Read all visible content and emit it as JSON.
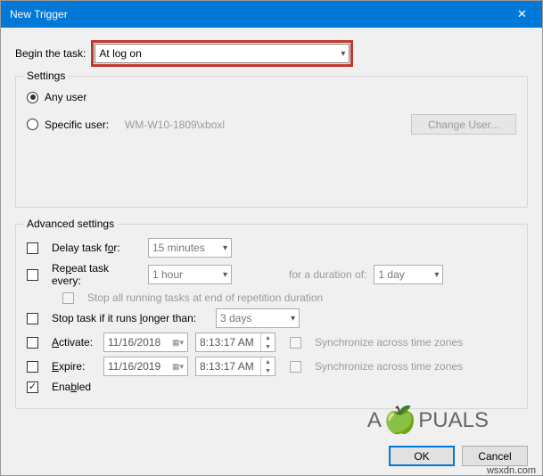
{
  "window": {
    "title": "New Trigger",
    "close_glyph": "✕"
  },
  "begin": {
    "label": "Begin the task:",
    "value": "At log on"
  },
  "settings": {
    "title": "Settings",
    "any_user": "Any user",
    "specific_user": "Specific user:",
    "user_value": "WM-W10-1809\\xboxl",
    "change_user": "Change User..."
  },
  "advanced": {
    "title": "Advanced settings",
    "delay_label": "Delay task for:",
    "delay_value": "15 minutes",
    "repeat_label": "Repeat task every:",
    "repeat_value": "1 hour",
    "duration_label": "for a duration of:",
    "duration_value": "1 day",
    "stop_repetition": "Stop all running tasks at end of repetition duration",
    "stop_longer": "Stop task if it runs longer than:",
    "stop_longer_value": "3 days",
    "activate": "Activate:",
    "activate_date": "11/16/2018",
    "activate_time": "8:13:17 AM",
    "expire": "Expire:",
    "expire_date": "11/16/2019",
    "expire_time": "8:13:17 AM",
    "sync_tz": "Synchronize across time zones",
    "enabled": "Enabled"
  },
  "footer": {
    "ok": "OK",
    "cancel": "Cancel"
  },
  "watermark": {
    "brand": "A  PUALS",
    "site": "wsxdn.com"
  }
}
